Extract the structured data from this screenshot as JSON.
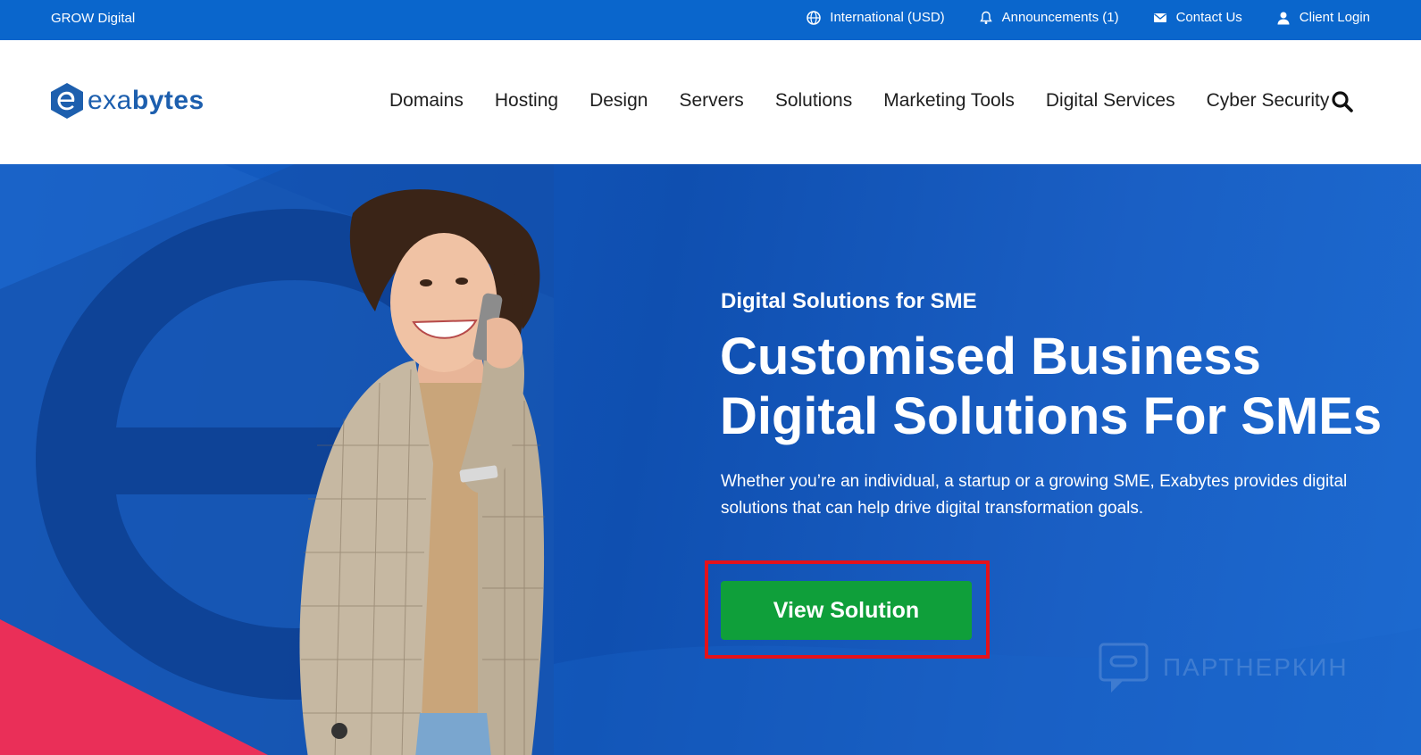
{
  "topbar": {
    "brand": "GROW Digital",
    "links": {
      "region": "International (USD)",
      "announcements": "Announcements (1)",
      "contact": "Contact Us",
      "login": "Client Login"
    }
  },
  "header": {
    "logo_prefix": "exa",
    "logo_suffix": "bytes",
    "nav": {
      "domains": "Domains",
      "hosting": "Hosting",
      "design": "Design",
      "servers": "Servers",
      "solutions": "Solutions",
      "marketing": "Marketing Tools",
      "digital_services": "Digital Services",
      "cyber_security": "Cyber Security"
    }
  },
  "hero": {
    "eyebrow": "Digital Solutions for SME",
    "headline_line1": "Customised Business",
    "headline_line2": "Digital Solutions For SMEs",
    "description": "Whether you’re an individual, a startup or a growing SME, Exabytes provides digital solutions that can help drive digital transformation goals.",
    "cta_label": "View Solution"
  },
  "watermark": {
    "text": "ПАРТНЕРКИН"
  },
  "colors": {
    "topbar": "#0a66cc",
    "brand_blue": "#1d5fae",
    "hero_blue": "#0f4fb0",
    "cta_green": "#0f9f3a",
    "highlight_red": "#e3121b"
  }
}
